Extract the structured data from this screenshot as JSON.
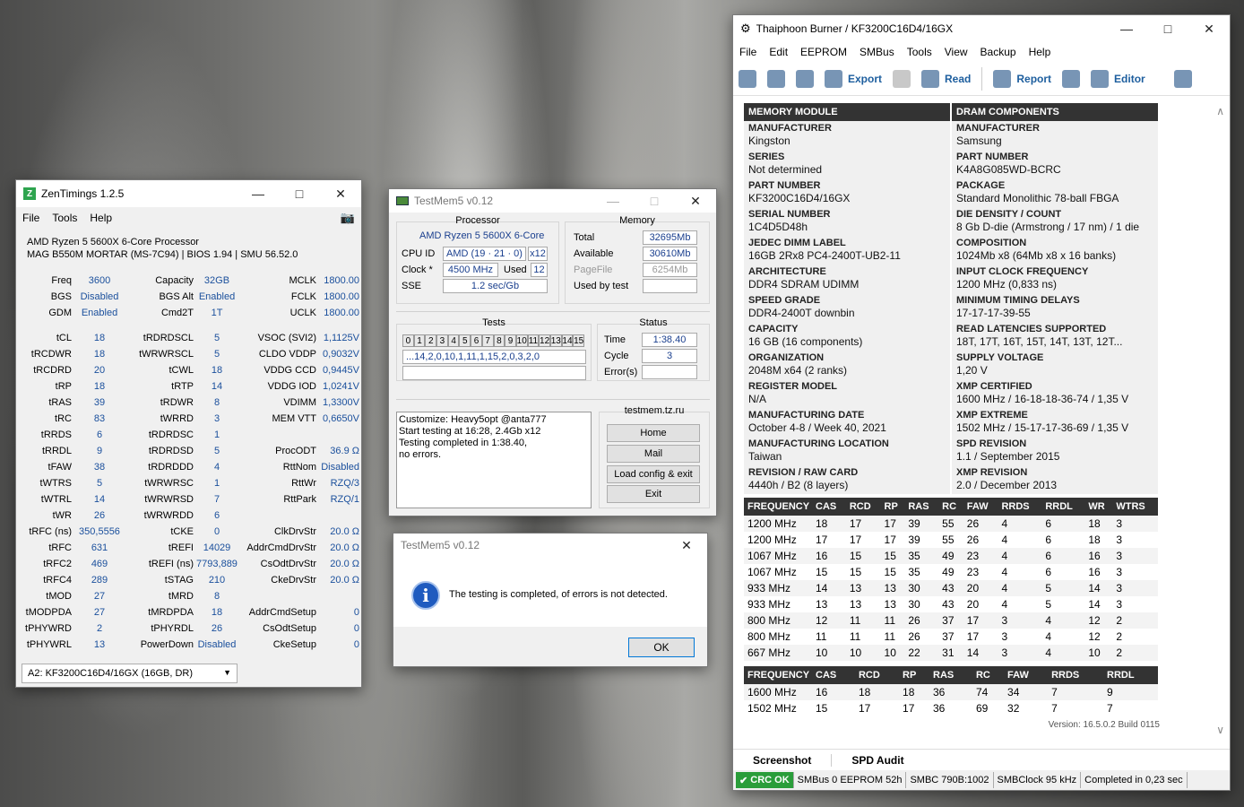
{
  "zentimings": {
    "title": "ZenTimings 1.2.5",
    "menu": [
      "File",
      "Tools",
      "Help"
    ],
    "cpu": "AMD Ryzen 5 5600X 6-Core Processor",
    "board": "MAG B550M MORTAR (MS-7C94) | BIOS 1.94 | SMU 56.52.0",
    "rows": [
      [
        "Freq",
        "3600",
        "Capacity",
        "32GB",
        "MCLK",
        "1800.00"
      ],
      [
        "BGS",
        "Disabled",
        "BGS Alt",
        "Enabled",
        "FCLK",
        "1800.00"
      ],
      [
        "GDM",
        "Enabled",
        "Cmd2T",
        "1T",
        "UCLK",
        "1800.00"
      ],
      null,
      [
        "tCL",
        "18",
        "tRDRDSCL",
        "5",
        "VSOC (SVI2)",
        "1,1125V"
      ],
      [
        "tRCDWR",
        "18",
        "tWRWRSCL",
        "5",
        "CLDO VDDP",
        "0,9032V"
      ],
      [
        "tRCDRD",
        "20",
        "tCWL",
        "18",
        "VDDG CCD",
        "0,9445V"
      ],
      [
        "tRP",
        "18",
        "tRTP",
        "14",
        "VDDG IOD",
        "1,0241V"
      ],
      [
        "tRAS",
        "39",
        "tRDWR",
        "8",
        "VDIMM",
        "1,3300V"
      ],
      [
        "tRC",
        "83",
        "tWRRD",
        "3",
        "MEM VTT",
        "0,6650V"
      ],
      [
        "tRRDS",
        "6",
        "tRDRDSC",
        "1",
        "",
        ""
      ],
      [
        "tRRDL",
        "9",
        "tRDRDSD",
        "5",
        "ProcODT",
        "36.9 Ω"
      ],
      [
        "tFAW",
        "38",
        "tRDRDDD",
        "4",
        "RttNom",
        "Disabled"
      ],
      [
        "tWTRS",
        "5",
        "tWRWRSC",
        "1",
        "RttWr",
        "RZQ/3"
      ],
      [
        "tWTRL",
        "14",
        "tWRWRSD",
        "7",
        "RttPark",
        "RZQ/1"
      ],
      [
        "tWR",
        "26",
        "tWRWRDD",
        "6",
        "",
        ""
      ],
      [
        "tRFC (ns)",
        "350,5556",
        "tCKE",
        "0",
        "ClkDrvStr",
        "20.0 Ω"
      ],
      [
        "tRFC",
        "631",
        "tREFI",
        "14029",
        "AddrCmdDrvStr",
        "20.0 Ω"
      ],
      [
        "tRFC2",
        "469",
        "tREFI (ns)",
        "7793,889",
        "CsOdtDrvStr",
        "20.0 Ω"
      ],
      [
        "tRFC4",
        "289",
        "tSTAG",
        "210",
        "CkeDrvStr",
        "20.0 Ω"
      ],
      [
        "tMOD",
        "27",
        "tMRD",
        "8",
        "",
        ""
      ],
      [
        "tMODPDA",
        "27",
        "tMRDPDA",
        "18",
        "AddrCmdSetup",
        "0"
      ],
      [
        "tPHYWRD",
        "2",
        "tPHYRDL",
        "26",
        "CsOdtSetup",
        "0"
      ],
      [
        "tPHYWRL",
        "13",
        "PowerDown",
        "Disabled",
        "CkeSetup",
        "0"
      ]
    ],
    "dimm_select": "A2: KF3200C16D4/16GX (16GB, DR)"
  },
  "testmem": {
    "title": "TestMem5 v0.12",
    "processor_title": "Processor",
    "processor_name": "AMD Ryzen 5 5600X 6-Core",
    "cpu_id_label": "CPU ID",
    "cpu_id": "AMD  (19 · 21 · 0)",
    "cpu_id_threads": "x12",
    "clock_label": "Clock *",
    "clock": "4500 MHz",
    "used_label": "Used",
    "used": "12",
    "sse_label": "SSE",
    "sse": "1.2 sec/Gb",
    "memory_title": "Memory",
    "total_label": "Total",
    "total": "32695Mb",
    "available_label": "Available",
    "available": "30610Mb",
    "pagefile_label": "PageFile",
    "pagefile": "6254Mb",
    "usedby_label": "Used by test",
    "usedby": "",
    "tests_title": "Tests",
    "test_ids": [
      "0",
      "1",
      "2",
      "3",
      "4",
      "5",
      "6",
      "7",
      "8",
      "9",
      "10",
      "11",
      "12",
      "13",
      "14",
      "15"
    ],
    "test_sequence": "...14,2,0,10,1,11,1,15,2,0,3,2,0",
    "status_title": "Status",
    "time_label": "Time",
    "time": "1:38.40",
    "cycle_label": "Cycle",
    "cycle": "3",
    "errors_label": "Error(s)",
    "errors": "",
    "log": [
      "Customize: Heavy5opt @anta777",
      "Start testing at 16:28, 2.4Gb x12",
      "Testing completed in 1:38.40,",
      "no errors."
    ],
    "site": "testmem.tz.ru",
    "buttons": [
      "Home",
      "Mail",
      "Load config & exit",
      "Exit"
    ]
  },
  "dialog": {
    "title": "TestMem5 v0.12",
    "message": "The testing is completed, of errors is not detected.",
    "ok": "OK"
  },
  "thaiphoon": {
    "title": "Thaiphoon Burner / KF3200C16D4/16GX",
    "menu": [
      "File",
      "Edit",
      "EEPROM",
      "SMBus",
      "Tools",
      "View",
      "Backup",
      "Help"
    ],
    "toolbar": {
      "export": "Export",
      "read": "Read",
      "report": "Report",
      "editor": "Editor"
    },
    "head_left": "MEMORY MODULE",
    "head_right": "DRAM COMPONENTS",
    "spd_rows": [
      [
        [
          "MANUFACTURER",
          "Kingston"
        ],
        [
          "MANUFACTURER",
          "Samsung"
        ]
      ],
      [
        [
          "SERIES",
          "Not determined"
        ],
        [
          "PART NUMBER",
          "K4A8G085WD-BCRC"
        ]
      ],
      [
        [
          "PART NUMBER",
          "KF3200C16D4/16GX"
        ],
        [
          "PACKAGE",
          "Standard Monolithic 78-ball FBGA"
        ]
      ],
      [
        [
          "SERIAL NUMBER",
          "1C4D5D48h"
        ],
        [
          "DIE DENSITY / COUNT",
          "8 Gb D-die (Armstrong / 17 nm) / 1 die"
        ]
      ],
      [
        [
          "JEDEC DIMM LABEL",
          "16GB 2Rx8 PC4-2400T-UB2-11"
        ],
        [
          "COMPOSITION",
          "1024Mb x8 (64Mb x8 x 16 banks)"
        ]
      ],
      [
        [
          "ARCHITECTURE",
          "DDR4 SDRAM UDIMM"
        ],
        [
          "INPUT CLOCK FREQUENCY",
          "1200 MHz (0,833 ns)"
        ]
      ],
      [
        [
          "SPEED GRADE",
          "DDR4-2400T downbin"
        ],
        [
          "MINIMUM TIMING DELAYS",
          "17-17-17-39-55"
        ]
      ],
      [
        [
          "CAPACITY",
          "16 GB (16 components)"
        ],
        [
          "READ LATENCIES SUPPORTED",
          "18T, 17T, 16T, 15T, 14T, 13T, 12T..."
        ]
      ],
      [
        [
          "ORGANIZATION",
          "2048M x64 (2 ranks)"
        ],
        [
          "SUPPLY VOLTAGE",
          "1,20 V"
        ]
      ],
      [
        [
          "REGISTER MODEL",
          "N/A"
        ],
        [
          "XMP CERTIFIED",
          "1600 MHz / 16-18-18-36-74 / 1,35 V"
        ]
      ],
      [
        [
          "MANUFACTURING DATE",
          "October 4-8 / Week 40, 2021"
        ],
        [
          "XMP EXTREME",
          "1502 MHz / 15-17-17-36-69 / 1,35 V"
        ]
      ],
      [
        [
          "MANUFACTURING LOCATION",
          "Taiwan"
        ],
        [
          "SPD REVISION",
          "1.1 / September 2015"
        ]
      ],
      [
        [
          "REVISION / RAW CARD",
          "4440h / B2 (8 layers)"
        ],
        [
          "XMP REVISION",
          "2.0 / December 2013"
        ]
      ]
    ],
    "jedec_headers": [
      "FREQUENCY",
      "CAS",
      "RCD",
      "RP",
      "RAS",
      "RC",
      "FAW",
      "RRDS",
      "RRDL",
      "WR",
      "WTRS"
    ],
    "jedec_rows": [
      [
        "1200 MHz",
        "18",
        "17",
        "17",
        "39",
        "55",
        "26",
        "4",
        "6",
        "18",
        "3"
      ],
      [
        "1200 MHz",
        "17",
        "17",
        "17",
        "39",
        "55",
        "26",
        "4",
        "6",
        "18",
        "3"
      ],
      [
        "1067 MHz",
        "16",
        "15",
        "15",
        "35",
        "49",
        "23",
        "4",
        "6",
        "16",
        "3"
      ],
      [
        "1067 MHz",
        "15",
        "15",
        "15",
        "35",
        "49",
        "23",
        "4",
        "6",
        "16",
        "3"
      ],
      [
        "933 MHz",
        "14",
        "13",
        "13",
        "30",
        "43",
        "20",
        "4",
        "5",
        "14",
        "3"
      ],
      [
        "933 MHz",
        "13",
        "13",
        "13",
        "30",
        "43",
        "20",
        "4",
        "5",
        "14",
        "3"
      ],
      [
        "800 MHz",
        "12",
        "11",
        "11",
        "26",
        "37",
        "17",
        "3",
        "4",
        "12",
        "2"
      ],
      [
        "800 MHz",
        "11",
        "11",
        "11",
        "26",
        "37",
        "17",
        "3",
        "4",
        "12",
        "2"
      ],
      [
        "667 MHz",
        "10",
        "10",
        "10",
        "22",
        "31",
        "14",
        "3",
        "4",
        "10",
        "2"
      ]
    ],
    "xmp_headers": [
      "FREQUENCY",
      "CAS",
      "RCD",
      "RP",
      "RAS",
      "RC",
      "FAW",
      "RRDS",
      "RRDL"
    ],
    "xmp_rows": [
      [
        "1600 MHz",
        "16",
        "18",
        "18",
        "36",
        "74",
        "34",
        "7",
        "9"
      ],
      [
        "1502 MHz",
        "15",
        "17",
        "17",
        "36",
        "69",
        "32",
        "7",
        "7"
      ]
    ],
    "version": "Version: 16.5.0.2 Build 0115",
    "tabs": [
      "Screenshot",
      "SPD Audit"
    ],
    "status": [
      "CRC OK",
      "SMBus 0 EEPROM 52h",
      "SMBC 790B:1002",
      "SMBClock 95 kHz",
      "Completed in 0,23 sec"
    ]
  }
}
